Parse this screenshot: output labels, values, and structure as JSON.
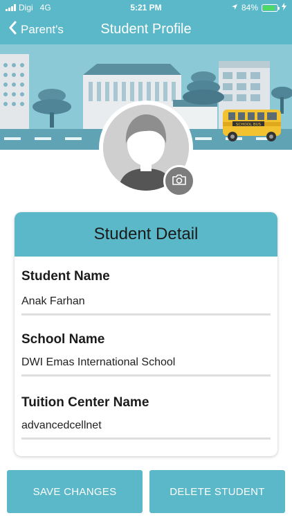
{
  "status_bar": {
    "carrier": "Digi",
    "network": "4G",
    "time": "5:21 PM",
    "battery": "84%",
    "battery_fraction": 0.84
  },
  "nav": {
    "back_label": "Parent's",
    "title": "Student Profile"
  },
  "banner": {
    "bus_sign": "SCHOOL BUS"
  },
  "card": {
    "title": "Student Detail",
    "fields": [
      {
        "label": "Student Name",
        "value": "Anak Farhan"
      },
      {
        "label": "School Name",
        "value": "DWI Emas International School"
      },
      {
        "label": "Tuition Center Name",
        "value": "advancedcellnet"
      }
    ]
  },
  "buttons": {
    "save": "SAVE CHANGES",
    "delete": "DELETE STUDENT"
  },
  "colors": {
    "accent": "#5bb8c8",
    "banner_bg": "#8cc9d6"
  }
}
